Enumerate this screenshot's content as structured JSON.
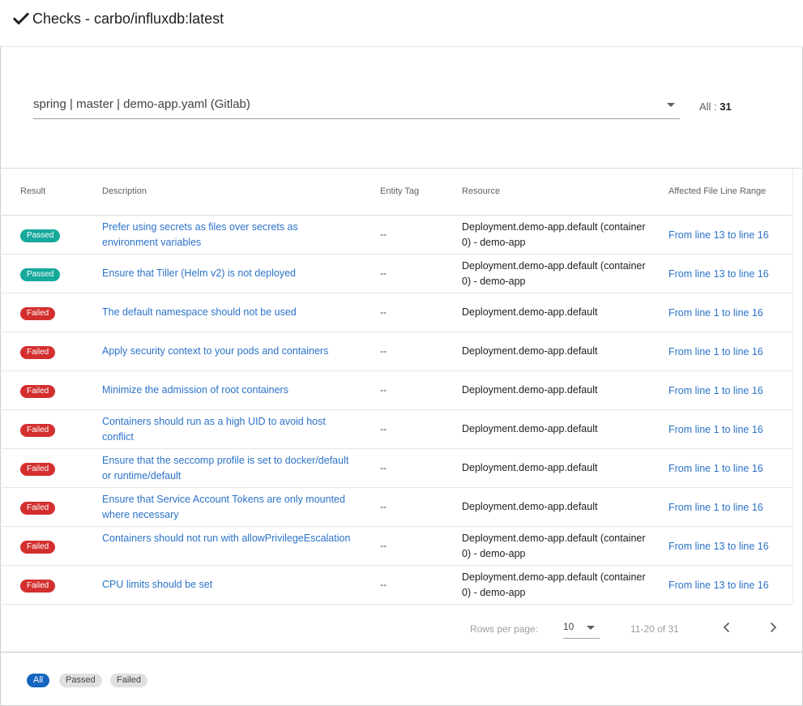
{
  "header": {
    "title": "Checks - carbo/influxdb:latest",
    "icon": "checkmark-icon"
  },
  "selector": {
    "value": "spring | master | demo-app.yaml (Gitlab)"
  },
  "count": {
    "label": "All : ",
    "value": "31"
  },
  "table": {
    "columns": [
      "Result",
      "Description",
      "Entity Tag",
      "Resource",
      "Affected File Line Range"
    ],
    "rows": [
      {
        "result": "Passed",
        "description": "Prefer using secrets as files over secrets as environment variables",
        "tag": "--",
        "resource": "Deployment.demo-app.default (container 0) - demo-app",
        "range": "From line 13 to line 16"
      },
      {
        "result": "Passed",
        "description": "Ensure that Tiller (Helm v2) is not deployed",
        "tag": "--",
        "resource": "Deployment.demo-app.default (container 0) - demo-app",
        "range": "From line 13 to line 16"
      },
      {
        "result": "Failed",
        "description": "The default namespace should not be used",
        "tag": "--",
        "resource": "Deployment.demo-app.default",
        "range": "From line 1 to line 16"
      },
      {
        "result": "Failed",
        "description": "Apply security context to your pods and containers",
        "tag": "--",
        "resource": "Deployment.demo-app.default",
        "range": "From line 1 to line 16"
      },
      {
        "result": "Failed",
        "description": "Minimize the admission of root containers",
        "tag": "--",
        "resource": "Deployment.demo-app.default",
        "range": "From line 1 to line 16"
      },
      {
        "result": "Failed",
        "description": "Containers should run as a high UID to avoid host conflict",
        "tag": "--",
        "resource": "Deployment.demo-app.default",
        "range": "From line 1 to line 16"
      },
      {
        "result": "Failed",
        "description": "Ensure that the seccomp profile is set to docker/default or runtime/default",
        "tag": "--",
        "resource": "Deployment.demo-app.default",
        "range": "From line 1 to line 16"
      },
      {
        "result": "Failed",
        "description": "Ensure that Service Account Tokens are only mounted where necessary",
        "tag": "--",
        "resource": "Deployment.demo-app.default",
        "range": "From line 1 to line 16"
      },
      {
        "result": "Failed",
        "description": "Containers should not run with allowPrivilegeEscalation",
        "tag": "--",
        "resource": "Deployment.demo-app.default (container 0) - demo-app",
        "range": "From line 13 to line 16"
      },
      {
        "result": "Failed",
        "description": "CPU limits should be set",
        "tag": "--",
        "resource": "Deployment.demo-app.default (container 0) - demo-app",
        "range": "From line 13 to line 16"
      }
    ]
  },
  "pagination": {
    "rows_per_page_label": "Rows per page:",
    "rows_per_page_value": "10",
    "range_label": "11-20 of 31",
    "prev_icon": "chevron-left-icon",
    "next_icon": "chevron-right-icon"
  },
  "filters": {
    "chips": [
      "All",
      "Passed",
      "Failed"
    ],
    "active": "All"
  },
  "colors": {
    "passed": "#16a99c",
    "failed": "#d32f2f",
    "link": "#2b73c9",
    "chip_active": "#1565c0"
  }
}
